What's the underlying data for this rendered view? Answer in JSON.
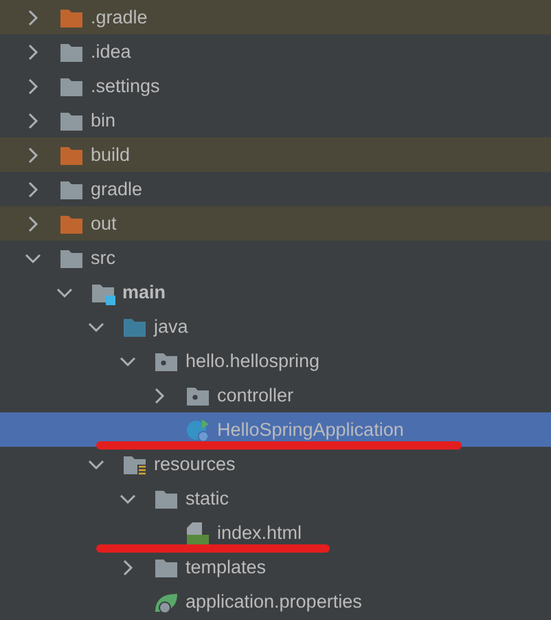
{
  "tree": [
    {
      "label": ".gradle",
      "kind": "excluded",
      "expanded": false,
      "selected": false
    },
    {
      "label": ".idea",
      "kind": "folder",
      "expanded": false,
      "selected": false
    },
    {
      "label": ".settings",
      "kind": "folder",
      "expanded": false,
      "selected": false
    },
    {
      "label": "bin",
      "kind": "folder",
      "expanded": false,
      "selected": false
    },
    {
      "label": "build",
      "kind": "excluded",
      "expanded": false,
      "selected": false
    },
    {
      "label": "gradle",
      "kind": "folder",
      "expanded": false,
      "selected": false
    },
    {
      "label": "out",
      "kind": "excluded",
      "expanded": false,
      "selected": false
    },
    {
      "label": "src",
      "kind": "folder",
      "expanded": true,
      "selected": false,
      "children": [
        {
          "label": "main",
          "kind": "module",
          "expanded": true,
          "selected": false,
          "children": [
            {
              "label": "java",
              "kind": "source",
              "expanded": true,
              "selected": false,
              "children": [
                {
                  "label": "hello.hellospring",
                  "kind": "package",
                  "expanded": true,
                  "selected": false,
                  "children": [
                    {
                      "label": "controller",
                      "kind": "package",
                      "expanded": false,
                      "selected": false
                    },
                    {
                      "label": "HelloSpringApplication",
                      "kind": "spring-class",
                      "selected": true,
                      "underlined": true
                    }
                  ]
                }
              ]
            },
            {
              "label": "resources",
              "kind": "resources",
              "expanded": true,
              "selected": false,
              "children": [
                {
                  "label": "static",
                  "kind": "folder",
                  "expanded": true,
                  "selected": false,
                  "children": [
                    {
                      "label": "index.html",
                      "kind": "html",
                      "selected": false,
                      "underlined": true
                    }
                  ]
                },
                {
                  "label": "templates",
                  "kind": "folder",
                  "expanded": false,
                  "selected": false
                },
                {
                  "label": "application.properties",
                  "kind": "properties",
                  "selected": false
                }
              ]
            }
          ]
        }
      ]
    }
  ]
}
